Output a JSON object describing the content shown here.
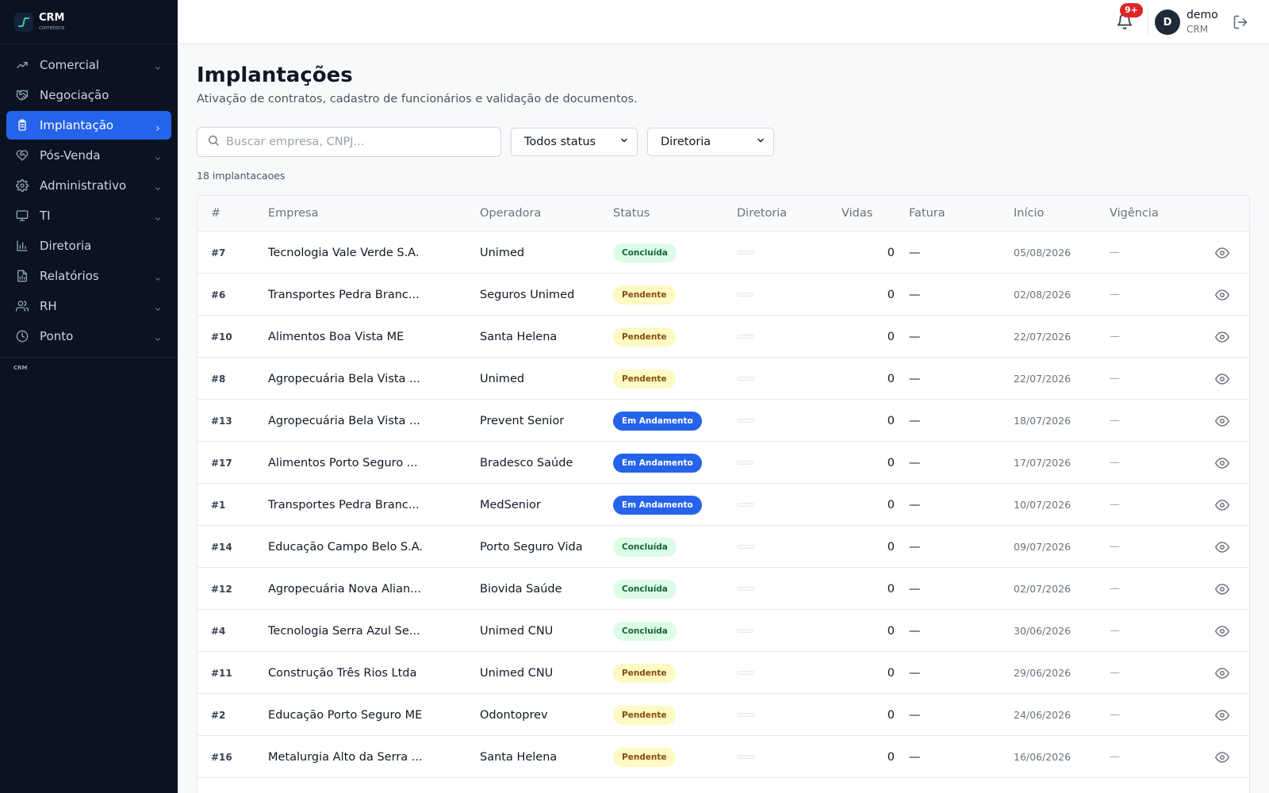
{
  "brand": {
    "title": "CRM",
    "subtitle": "corretora"
  },
  "sidebar": {
    "items": [
      {
        "label": "Comercial",
        "icon": "trending-up-icon",
        "chevron": true,
        "active": false
      },
      {
        "label": "Negociação",
        "icon": "handshake-icon",
        "chevron": false,
        "active": false
      },
      {
        "label": "Implantação",
        "icon": "clipboard-icon",
        "chevron": true,
        "active": true
      },
      {
        "label": "Pós-Venda",
        "icon": "heart-handshake-icon",
        "chevron": true,
        "active": false
      },
      {
        "label": "Administrativo",
        "icon": "gear-icon",
        "chevron": true,
        "active": false
      },
      {
        "label": "TI",
        "icon": "monitor-icon",
        "chevron": true,
        "active": false
      },
      {
        "label": "Diretoria",
        "icon": "bar-chart-icon",
        "chevron": false,
        "active": false
      },
      {
        "label": "Relatórios",
        "icon": "file-chart-icon",
        "chevron": true,
        "active": false
      },
      {
        "label": "RH",
        "icon": "users-icon",
        "chevron": true,
        "active": false
      },
      {
        "label": "Ponto",
        "icon": "clock-icon",
        "chevron": true,
        "active": false
      }
    ],
    "footer": "CRM"
  },
  "topbar": {
    "notifications_badge": "9+",
    "avatar_initial": "D",
    "user_name": "demo",
    "user_role": "CRM"
  },
  "page": {
    "title": "Implantações",
    "subtitle": "Ativação de contratos, cadastro de funcionários e validação de documentos."
  },
  "filters": {
    "search_placeholder": "Buscar empresa, CNPJ...",
    "status_value": "Todos status",
    "diretoria_value": "Diretoria"
  },
  "count_label": "18 implantacaoes",
  "table": {
    "headers": [
      "#",
      "Empresa",
      "Operadora",
      "Status",
      "Diretoria",
      "Vidas",
      "Fatura",
      "Início",
      "Vigência"
    ],
    "rows": [
      {
        "id": "#7",
        "empresa": "Tecnologia Vale Verde S.A.",
        "operadora": "Unimed",
        "status": "Concluída",
        "vidas": "0",
        "fatura": "—",
        "inicio": "05/08/2026",
        "vigencia": "—"
      },
      {
        "id": "#6",
        "empresa": "Transportes Pedra Branc...",
        "operadora": "Seguros Unimed",
        "status": "Pendente",
        "vidas": "0",
        "fatura": "—",
        "inicio": "02/08/2026",
        "vigencia": "—"
      },
      {
        "id": "#10",
        "empresa": "Alimentos Boa Vista ME",
        "operadora": "Santa Helena",
        "status": "Pendente",
        "vidas": "0",
        "fatura": "—",
        "inicio": "22/07/2026",
        "vigencia": "—"
      },
      {
        "id": "#8",
        "empresa": "Agropecuária Bela Vista ...",
        "operadora": "Unimed",
        "status": "Pendente",
        "vidas": "0",
        "fatura": "—",
        "inicio": "22/07/2026",
        "vigencia": "—"
      },
      {
        "id": "#13",
        "empresa": "Agropecuária Bela Vista ...",
        "operadora": "Prevent Senior",
        "status": "Em Andamento",
        "vidas": "0",
        "fatura": "—",
        "inicio": "18/07/2026",
        "vigencia": "—"
      },
      {
        "id": "#17",
        "empresa": "Alimentos Porto Seguro ...",
        "operadora": "Bradesco Saúde",
        "status": "Em Andamento",
        "vidas": "0",
        "fatura": "—",
        "inicio": "17/07/2026",
        "vigencia": "—"
      },
      {
        "id": "#1",
        "empresa": "Transportes Pedra Branc...",
        "operadora": "MedSenior",
        "status": "Em Andamento",
        "vidas": "0",
        "fatura": "—",
        "inicio": "10/07/2026",
        "vigencia": "—"
      },
      {
        "id": "#14",
        "empresa": "Educação Campo Belo S.A.",
        "operadora": "Porto Seguro Vida",
        "status": "Concluída",
        "vidas": "0",
        "fatura": "—",
        "inicio": "09/07/2026",
        "vigencia": "—"
      },
      {
        "id": "#12",
        "empresa": "Agropecuária Nova Alian...",
        "operadora": "Biovida Saúde",
        "status": "Concluída",
        "vidas": "0",
        "fatura": "—",
        "inicio": "02/07/2026",
        "vigencia": "—"
      },
      {
        "id": "#4",
        "empresa": "Tecnologia Serra Azul Se...",
        "operadora": "Unimed CNU",
        "status": "Concluída",
        "vidas": "0",
        "fatura": "—",
        "inicio": "30/06/2026",
        "vigencia": "—"
      },
      {
        "id": "#11",
        "empresa": "Construção Três Rios Ltda",
        "operadora": "Unimed CNU",
        "status": "Pendente",
        "vidas": "0",
        "fatura": "—",
        "inicio": "29/06/2026",
        "vigencia": "—"
      },
      {
        "id": "#2",
        "empresa": "Educação Porto Seguro ME",
        "operadora": "Odontoprev",
        "status": "Pendente",
        "vidas": "0",
        "fatura": "—",
        "inicio": "24/06/2026",
        "vigencia": "—"
      },
      {
        "id": "#16",
        "empresa": "Metalurgia Alto da Serra ...",
        "operadora": "Santa Helena",
        "status": "Pendente",
        "vidas": "0",
        "fatura": "—",
        "inicio": "16/06/2026",
        "vigencia": "—"
      }
    ]
  },
  "status_colors": {
    "Concluída": {
      "bg": "#dcfce7",
      "fg": "#166534"
    },
    "Pendente": {
      "bg": "#fef9c3",
      "fg": "#854d0e"
    },
    "Em Andamento": {
      "bg": "#2563eb",
      "fg": "#ffffff"
    }
  },
  "colors": {
    "sidebar_bg": "#0b1220",
    "accent": "#2563eb",
    "badge_red": "#dc2626"
  }
}
